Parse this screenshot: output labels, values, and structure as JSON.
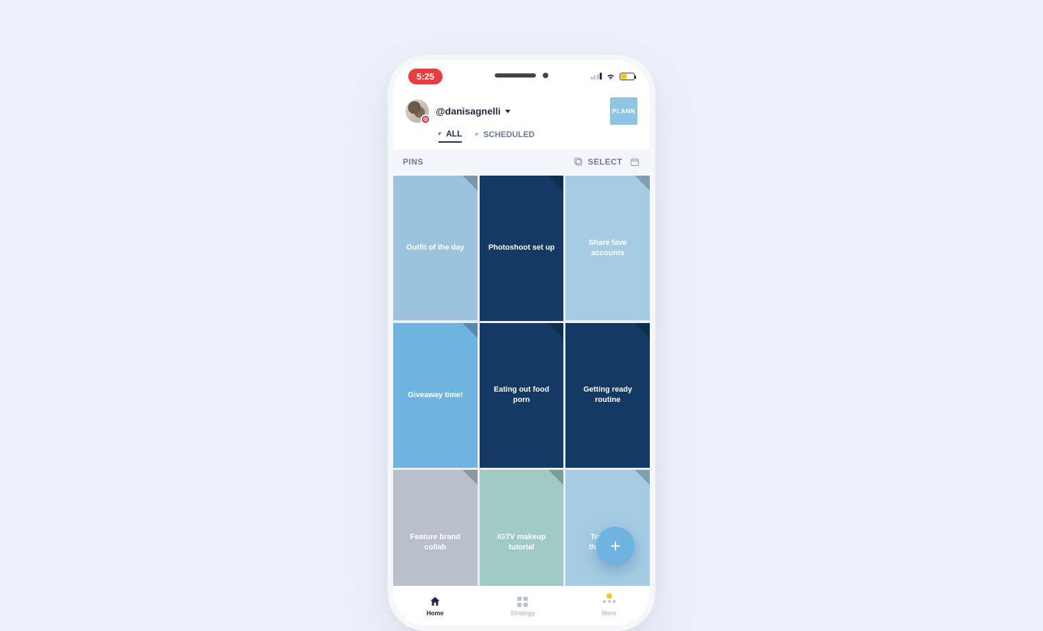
{
  "status": {
    "time": "5:25"
  },
  "header": {
    "handle": "@danisagnelli",
    "brand": "PLANN"
  },
  "tabs": {
    "all": "ALL",
    "scheduled": "SCHEDULED",
    "active": "all"
  },
  "subheader": {
    "title": "PINS",
    "select": "SELECT"
  },
  "pins": [
    {
      "label": "Outfit of the day",
      "color": "c-lightblue"
    },
    {
      "label": "Photoshoot set up",
      "color": "c-navy"
    },
    {
      "label": "Share fave accounts",
      "color": "c-paleblue"
    },
    {
      "label": "Giveaway time!",
      "color": "c-skyblue"
    },
    {
      "label": "Eating out food porn",
      "color": "c-navy"
    },
    {
      "label": "Getting ready routine",
      "color": "c-navy"
    },
    {
      "label": "Feature brand collab",
      "color": "c-gray"
    },
    {
      "label": "IGTV makeup tutorial",
      "color": "c-teal"
    },
    {
      "label": "Travel pic throwback",
      "color": "c-paleblue"
    }
  ],
  "fab": {
    "glyph": "+"
  },
  "nav": {
    "home": "Home",
    "strategy": "Strategy",
    "more": "More",
    "active": "home"
  }
}
